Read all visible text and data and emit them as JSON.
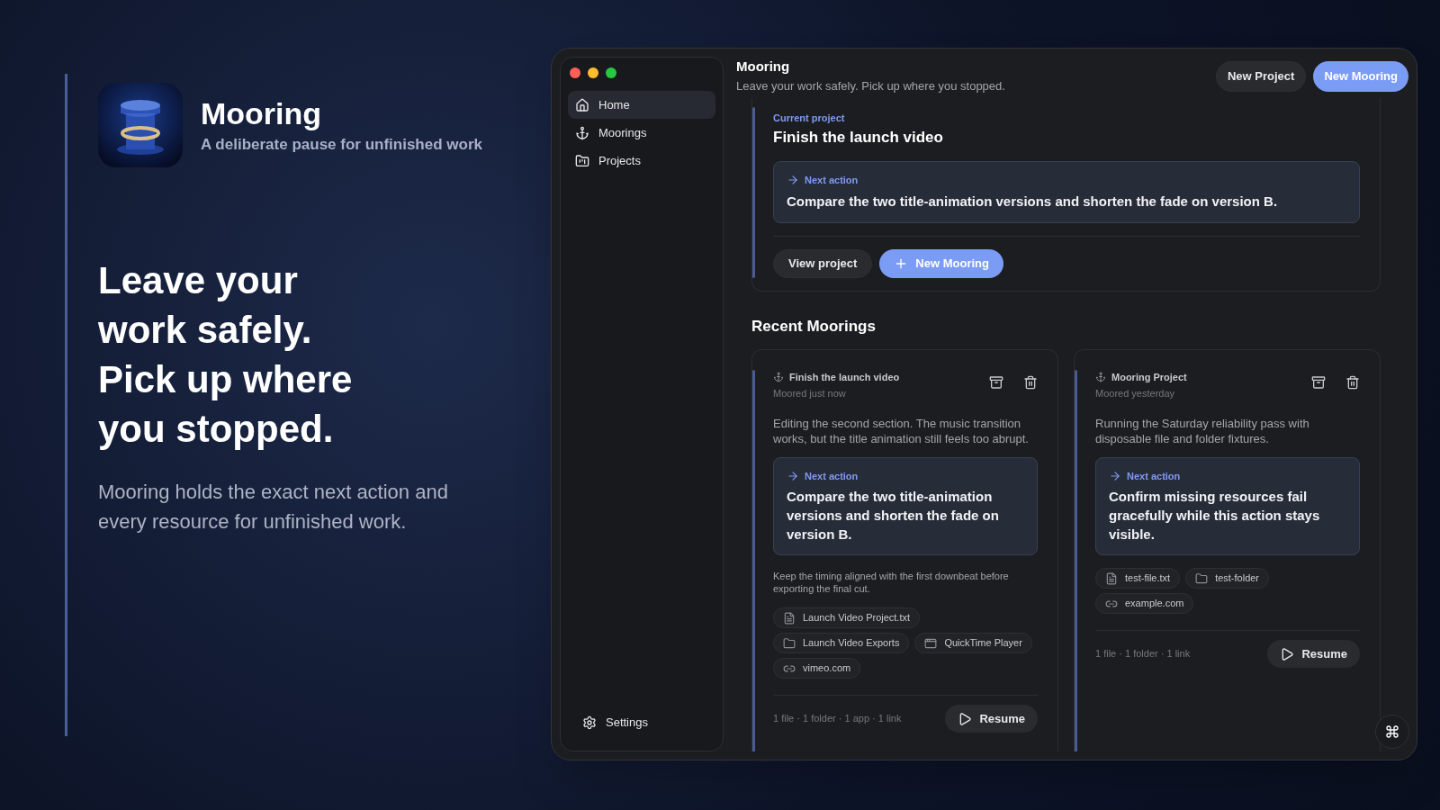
{
  "promo": {
    "app_name": "Mooring",
    "tagline": "A deliberate pause for unfinished work",
    "headline": [
      "Leave your",
      "work safely.",
      "Pick up where",
      "you stopped."
    ],
    "description": "Mooring holds the exact next action and every resource for unfinished work."
  },
  "sidebar": {
    "items": [
      {
        "label": "Home",
        "kind": "home",
        "selected": true
      },
      {
        "label": "Moorings",
        "kind": "anchor",
        "selected": false
      },
      {
        "label": "Projects",
        "kind": "folder",
        "selected": false
      }
    ],
    "settings": "Settings"
  },
  "header": {
    "title": "Mooring",
    "subtitle": "Leave your work safely. Pick up where you stopped.",
    "buttons": [
      {
        "label": "New Project",
        "kind": "secondary"
      },
      {
        "label": "New Mooring",
        "kind": "primary"
      }
    ]
  },
  "current_project": {
    "label": "Current project",
    "title": "Finish the launch video",
    "next_action_label": "Next action",
    "next_action": "Compare the two title-animation versions and shorten the fade on version B.",
    "buttons": [
      {
        "label": "View project",
        "kind": "secondary"
      },
      {
        "label": "New Mooring",
        "kind": "primary"
      }
    ]
  },
  "recent": {
    "title": "Recent Moorings",
    "cards": [
      {
        "project": "Finish the launch video",
        "moored": "Moored just now",
        "summary": "Editing the second section. The music transition works, but the title animation still feels too abrupt.",
        "next_action_label": "Next action",
        "next_action": "Compare the two title-animation versions and shorten the fade on version B.",
        "note": "Keep the timing aligned with the first downbeat before exporting the final cut.",
        "resources": [
          {
            "kind": "file",
            "label": "Launch Video Project.txt"
          },
          {
            "kind": "folder",
            "label": "Launch Video Exports"
          },
          {
            "kind": "app",
            "label": "QuickTime Player"
          },
          {
            "kind": "link",
            "label": "vimeo.com"
          }
        ],
        "counts": "1 file · 1 folder · 1 app · 1 link",
        "resume": "Resume"
      },
      {
        "project": "Mooring Project",
        "moored": "Moored yesterday",
        "summary": "Running the Saturday reliability pass with disposable file and folder fixtures.",
        "next_action_label": "Next action",
        "next_action": "Confirm missing resources fail gracefully while this action stays visible.",
        "resources": [
          {
            "kind": "file",
            "label": "test-file.txt"
          },
          {
            "kind": "folder",
            "label": "test-folder"
          },
          {
            "kind": "link",
            "label": "example.com"
          }
        ],
        "counts": "1 file · 1 folder · 1 link",
        "resume": "Resume"
      }
    ]
  }
}
